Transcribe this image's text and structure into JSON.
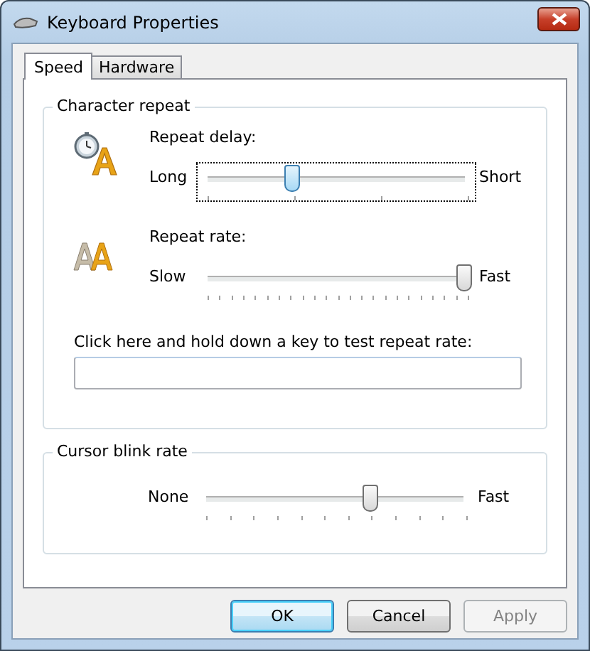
{
  "window": {
    "title": "Keyboard Properties"
  },
  "tabs": [
    {
      "label": "Speed",
      "selected": true
    },
    {
      "label": "Hardware",
      "selected": false
    }
  ],
  "character_repeat": {
    "title": "Character repeat",
    "settings": [
      {
        "kind": "delay",
        "label": "Repeat delay:",
        "min_label": "Long",
        "max_label": "Short",
        "level": 0.33,
        "focused": true
      },
      {
        "kind": "rate",
        "label": "Repeat rate:",
        "min_label": "Slow",
        "max_label": "Fast",
        "level": 1,
        "focused": false
      }
    ],
    "test": {
      "label": "Click here and hold down a key to test repeat rate:"
    }
  },
  "cursor_blink": {
    "title": "Cursor blink rate",
    "min_label": "None",
    "max_label": "Fast",
    "level": 0.64,
    "focused": false
  },
  "buttons": [
    {
      "label": "OK",
      "default": true,
      "disabled": false
    },
    {
      "label": "Cancel",
      "default": false,
      "disabled": false
    },
    {
      "label": "Apply",
      "default": false,
      "disabled": true
    }
  ]
}
